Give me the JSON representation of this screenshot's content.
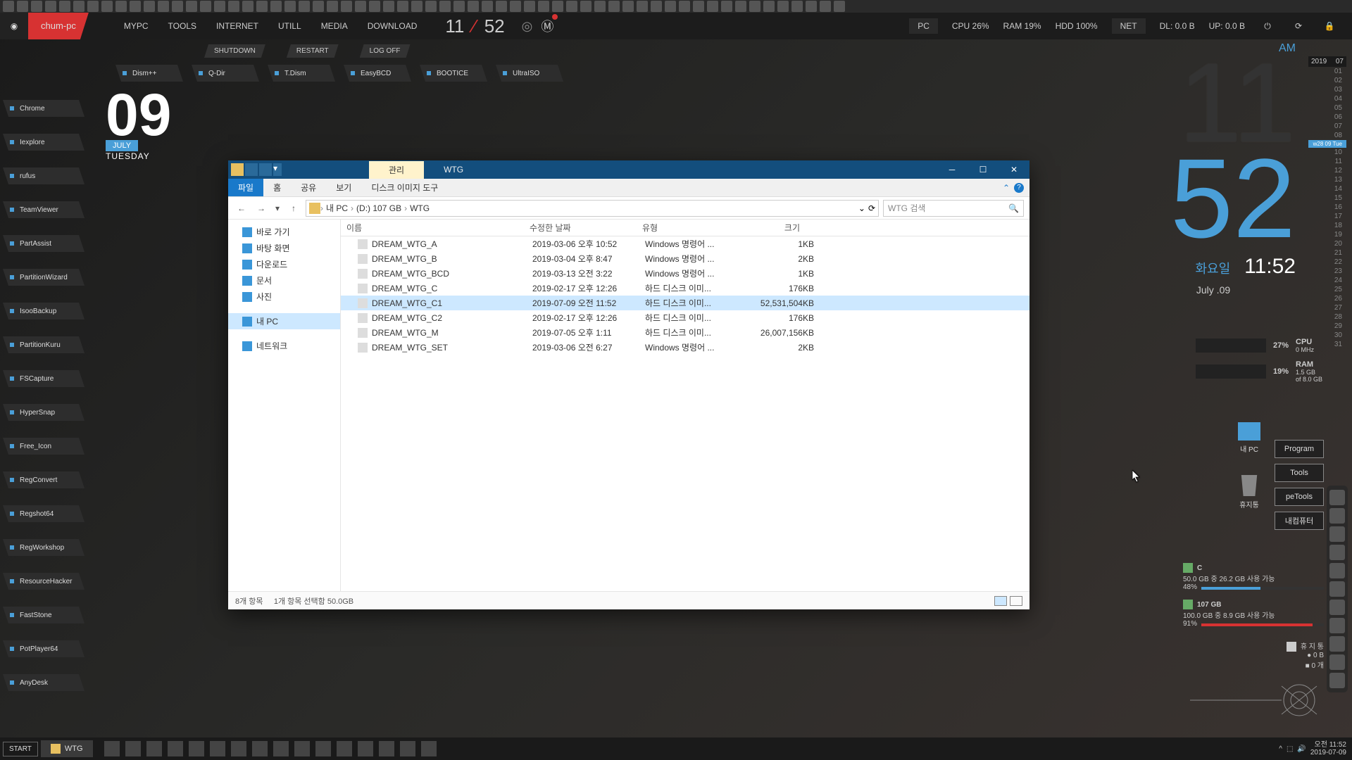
{
  "menubar": {
    "hostname": "chum-pc",
    "items": [
      "MYPC",
      "TOOLS",
      "INTERNET",
      "UTILL",
      "MEDIA",
      "DOWNLOAD"
    ],
    "clock_h": "11",
    "clock_m": "52",
    "right_pc": "PC",
    "right_cpu": "CPU  26%",
    "right_ram": "RAM  19%",
    "right_hdd": "HDD  100%",
    "right_net": "NET",
    "right_dl": "DL: 0.0 B",
    "right_up": "UP: 0.0 B"
  },
  "sysrow": [
    "SHUTDOWN",
    "RESTART",
    "LOG OFF"
  ],
  "launch_row1": [
    "Dism++",
    "Q-Dir",
    "T.Dism",
    "EasyBCD",
    "BOOTICE",
    "UltraISO"
  ],
  "launchers": [
    "Chrome",
    "Iexplore",
    "rufus",
    "TeamViewer",
    "PartAssist",
    "PartitionWizard",
    "IsooBackup",
    "PartitionKuru",
    "FSCapture",
    "HyperSnap",
    "Free_Icon",
    "RegConvert",
    "Regshot64",
    "RegWorkshop",
    "ResourceHacker",
    "FastStone",
    "PotPlayer64",
    "AnyDesk"
  ],
  "datewidget": {
    "day": "09",
    "month": "JULY",
    "dow": "TUESDAY"
  },
  "explorer": {
    "tab_manage": "관리",
    "tab_title": "WTG",
    "ribbon_file": "파일",
    "ribbon_tabs": [
      "홈",
      "공유",
      "보기",
      "디스크 이미지 도구"
    ],
    "nav_crumbs": [
      "내 PC",
      "(D:) 107 GB",
      "WTG"
    ],
    "search_placeholder": "WTG 검색",
    "cols": {
      "name": "이름",
      "date": "수정한 날짜",
      "type": "유형",
      "size": "크기"
    },
    "tree": [
      {
        "label": "바로 가기",
        "icon": "star",
        "color": "#3a96d8"
      },
      {
        "label": "바탕 화면",
        "icon": "desktop",
        "color": "#3a96d8"
      },
      {
        "label": "다운로드",
        "icon": "download",
        "color": "#3a96d8"
      },
      {
        "label": "문서",
        "icon": "doc",
        "color": "#3a96d8"
      },
      {
        "label": "사진",
        "icon": "pic",
        "color": "#3a96d8"
      },
      {
        "label": "내 PC",
        "icon": "pc",
        "color": "#3a96d8",
        "selected": true
      },
      {
        "label": "네트워크",
        "icon": "net",
        "color": "#3a96d8"
      }
    ],
    "files": [
      {
        "name": "DREAM_WTG_A",
        "date": "2019-03-06 오후 10:52",
        "type": "Windows 명령어 ...",
        "size": "1KB"
      },
      {
        "name": "DREAM_WTG_B",
        "date": "2019-03-04 오후 8:47",
        "type": "Windows 명령어 ...",
        "size": "2KB"
      },
      {
        "name": "DREAM_WTG_BCD",
        "date": "2019-03-13 오전 3:22",
        "type": "Windows 명령어 ...",
        "size": "1KB"
      },
      {
        "name": "DREAM_WTG_C",
        "date": "2019-02-17 오후 12:26",
        "type": "하드 디스크 이미...",
        "size": "176KB"
      },
      {
        "name": "DREAM_WTG_C1",
        "date": "2019-07-09 오전 11:52",
        "type": "하드 디스크 이미...",
        "size": "52,531,504KB",
        "selected": true
      },
      {
        "name": "DREAM_WTG_C2",
        "date": "2019-02-17 오후 12:26",
        "type": "하드 디스크 이미...",
        "size": "176KB"
      },
      {
        "name": "DREAM_WTG_M",
        "date": "2019-07-05 오후 1:11",
        "type": "하드 디스크 이미...",
        "size": "26,007,156KB"
      },
      {
        "name": "DREAM_WTG_SET",
        "date": "2019-03-06 오전 6:27",
        "type": "Windows 명령어 ...",
        "size": "2KB"
      }
    ],
    "status_left": "8개 항목",
    "status_sel": "1개 항목 선택함 50.0GB"
  },
  "rclock": {
    "ampm": "AM",
    "h": "11",
    "m": "52",
    "dow_kr": "화요일",
    "time": "11:52",
    "date": "July .09"
  },
  "calstrip": {
    "year": "2019",
    "month": "07",
    "today": 9,
    "week": "w28",
    "today_dow": "Tue"
  },
  "gauges": {
    "cpu_pct": "27%",
    "cpu_label": "CPU",
    "cpu_sub": "0 MHz",
    "ram_pct": "19%",
    "ram_label": "RAM",
    "ram_sub": "1.5 GB",
    "ram_sub2": "of 8.0 GB"
  },
  "rdesk": [
    {
      "label": "내 PC"
    },
    {
      "label": "휴지통"
    }
  ],
  "rfolders": [
    "Program",
    "Tools",
    "peTools",
    "내컴퓨터"
  ],
  "disks": [
    {
      "name": "C",
      "info": "50.0 GB 중  26.2 GB 사용 가능",
      "pct": "48%",
      "fill": 48
    },
    {
      "name": "107 GB",
      "info": "100.0 GB 중 8.9 GB 사용 가능",
      "pct": "91%",
      "fill": 91
    }
  ],
  "trash": {
    "label": "휴 지 통",
    "line1": "● 0 B",
    "line2": "■ 0 개"
  },
  "taskbar": {
    "start": "START",
    "task": "WTG",
    "tray_time": "오전 11:52",
    "tray_date": "2019-07-09"
  }
}
